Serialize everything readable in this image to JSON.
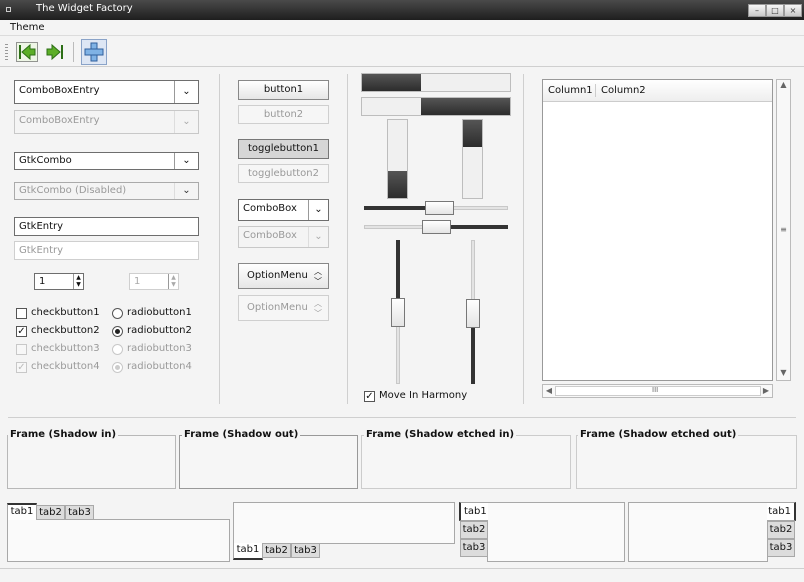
{
  "window": {
    "title": "The Widget Factory"
  },
  "menu": {
    "theme": "Theme"
  },
  "left": {
    "combo_entry": "ComboBoxEntry",
    "combo_entry_dis": "ComboBoxEntry",
    "gtkcombo": "GtkCombo",
    "gtkcombo_dis": "GtkCombo (Disabled)",
    "entry": "GtkEntry",
    "entry_dis": "GtkEntry",
    "spin": "1",
    "spin_dis": "1",
    "checks": [
      "checkbutton1",
      "checkbutton2",
      "checkbutton3",
      "checkbutton4"
    ],
    "radios": [
      "radiobutton1",
      "radiobutton2",
      "radiobutton3",
      "radiobutton4"
    ]
  },
  "middle": {
    "button1": "button1",
    "button2": "button2",
    "toggle1": "togglebutton1",
    "toggle2": "togglebutton2",
    "combobox": "ComboBox",
    "combobox_dis": "ComboBox",
    "option": "OptionMenu",
    "option_dis": "OptionMenu"
  },
  "progress": {
    "values": [
      0.4,
      0.6,
      0.35,
      0.35
    ]
  },
  "harmony": {
    "label": "Move In Harmony",
    "checked": true
  },
  "tree": {
    "columns": [
      "Column1",
      "Column2"
    ],
    "hscroll_grip": "III",
    "vscroll_grip": "≡"
  },
  "frames": [
    "Frame (Shadow in)",
    "Frame (Shadow out)",
    "Frame (Shadow etched in)",
    "Frame (Shadow etched out)"
  ],
  "tabs": [
    "tab1",
    "tab2",
    "tab3"
  ],
  "icons": {
    "back": "go-back-icon",
    "forward": "go-forward-icon",
    "add": "add-icon"
  }
}
